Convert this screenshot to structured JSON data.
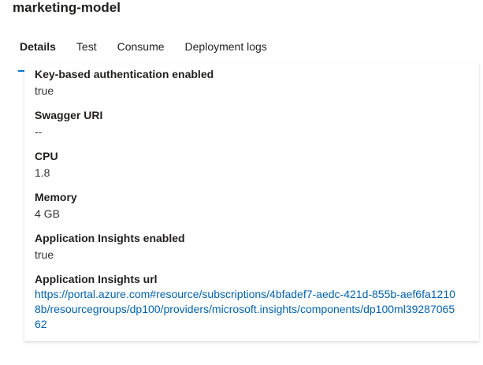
{
  "page": {
    "title": "marketing-model"
  },
  "tabs": [
    {
      "label": "Details",
      "active": true
    },
    {
      "label": "Test",
      "active": false
    },
    {
      "label": "Consume",
      "active": false
    },
    {
      "label": "Deployment logs",
      "active": false
    }
  ],
  "details": [
    {
      "label": "Key-based authentication enabled",
      "value": "true"
    },
    {
      "label": "Swagger URI",
      "value": "--"
    },
    {
      "label": "CPU",
      "value": "1.8"
    },
    {
      "label": "Memory",
      "value": "4 GB"
    },
    {
      "label": "Application Insights enabled",
      "value": "true"
    },
    {
      "label": "Application Insights url",
      "value": "https://portal.azure.com#resource/subscriptions/4bfadef7-aedc-421d-855b-aef6fa12108b/resourcegroups/dp100/providers/microsoft.insights/components/dp100ml3928706562"
    }
  ],
  "colors": {
    "accent": "#0078d4",
    "link": "#0063b1"
  }
}
